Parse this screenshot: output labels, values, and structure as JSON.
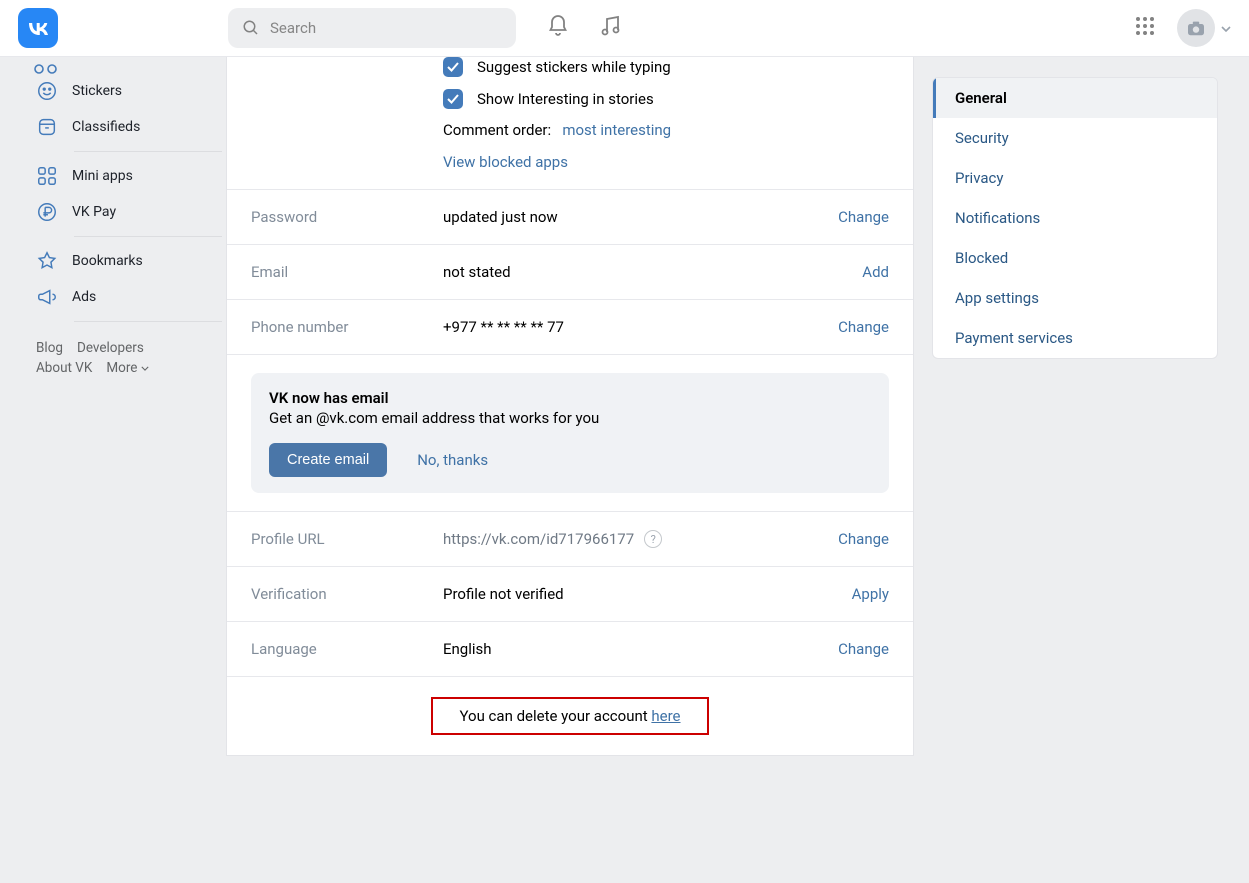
{
  "header": {
    "search_placeholder": "Search"
  },
  "left_nav": {
    "items": [
      {
        "icon": "smile",
        "label": "Stickers"
      },
      {
        "icon": "box",
        "label": "Classifieds"
      },
      {
        "icon": "apps",
        "label": "Mini apps"
      },
      {
        "icon": "ruble",
        "label": "VK Pay"
      },
      {
        "icon": "star",
        "label": "Bookmarks"
      },
      {
        "icon": "megaphone",
        "label": "Ads"
      }
    ],
    "footer": {
      "blog": "Blog",
      "developers": "Developers",
      "about": "About VK",
      "more": "More"
    }
  },
  "top": {
    "chk1": "Suggest stickers while typing",
    "chk2": "Show Interesting in stories",
    "comment_label": "Comment order:",
    "comment_value": "most interesting",
    "blocked": "View blocked apps"
  },
  "rows": {
    "password": {
      "label": "Password",
      "value": "updated just now",
      "action": "Change"
    },
    "email": {
      "label": "Email",
      "value": "not stated",
      "action": "Add"
    },
    "phone": {
      "label": "Phone number",
      "value": "+977 ** ** ** ** 77",
      "action": "Change"
    },
    "profile_url": {
      "label": "Profile URL",
      "prefix": "https://vk.com/",
      "id": "id717966177",
      "action": "Change"
    },
    "verification": {
      "label": "Verification",
      "value": "Profile not verified",
      "action": "Apply"
    },
    "language": {
      "label": "Language",
      "value": "English",
      "action": "Change"
    }
  },
  "promo": {
    "title": "VK now has email",
    "sub": "Get an @vk.com email address that works for you",
    "cta": "Create email",
    "dismiss": "No, thanks"
  },
  "delete": {
    "text": "You can delete your account ",
    "link": "here"
  },
  "side": {
    "items": [
      "General",
      "Security",
      "Privacy",
      "Notifications",
      "Blocked",
      "App settings",
      "Payment services"
    ]
  }
}
